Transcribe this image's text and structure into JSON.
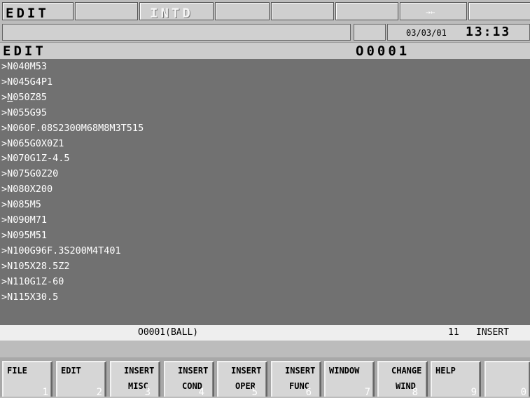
{
  "top": {
    "mode": "EDIT",
    "sub_mode": "INTD",
    "arrow": "→←",
    "message": "",
    "small_field": "",
    "date": "03/03/01",
    "time": "13:13"
  },
  "title": {
    "left": "EDIT",
    "right": "O0001"
  },
  "program_lines": [
    ">N040M53",
    ">N045G4P1",
    ">N050Z85",
    ">N055G95",
    ">N060F.08S2300M68M8M3T515",
    ">N065G0X0Z1",
    ">N070G1Z-4.5",
    ">N075G0Z20",
    ">N080X200",
    ">N085M5",
    ">N090M71",
    ">N095M51",
    ">N100G96F.3S200M4T401",
    ">N105X28.5Z2",
    ">N110G1Z-60",
    ">N115X30.5"
  ],
  "status": {
    "program": "O0001(BALL)",
    "line": "11",
    "mode": "INSERT"
  },
  "softkeys": [
    {
      "l1": "FILE",
      "l2": "",
      "num": "1"
    },
    {
      "l1": "EDIT",
      "l2": "",
      "num": "2"
    },
    {
      "l1": "INSERT",
      "l2": "MISC",
      "num": "3"
    },
    {
      "l1": "INSERT",
      "l2": "COND",
      "num": "4"
    },
    {
      "l1": "INSERT",
      "l2": "OPER",
      "num": "5"
    },
    {
      "l1": "INSERT",
      "l2": "FUNC",
      "num": "6"
    },
    {
      "l1": "WINDOW",
      "l2": "",
      "num": "7"
    },
    {
      "l1": "CHANGE",
      "l2": "WIND",
      "num": "8"
    },
    {
      "l1": "HELP",
      "l2": "",
      "num": "9"
    },
    {
      "l1": "",
      "l2": "",
      "num": "0"
    }
  ],
  "colors": {
    "program_bg": "#717171",
    "program_text": "#ffffff",
    "status_bg": "#eeeeee"
  }
}
